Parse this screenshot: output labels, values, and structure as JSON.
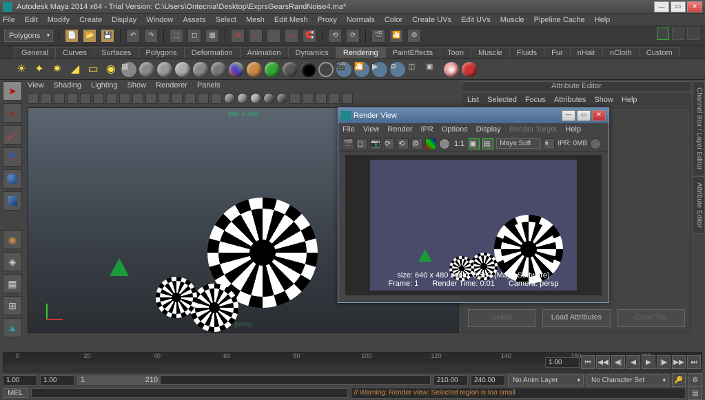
{
  "titlebar": {
    "text": "Autodesk Maya 2014 x64 - Trial Version: C:\\Users\\Ontecnia\\Desktop\\ExprsGearsRandNoise4.ma*"
  },
  "mainmenu": [
    "File",
    "Edit",
    "Modify",
    "Create",
    "Display",
    "Window",
    "Assets",
    "Select",
    "Mesh",
    "Edit Mesh",
    "Proxy",
    "Normals",
    "Color",
    "Create UVs",
    "Edit UVs",
    "Muscle",
    "Pipeline Cache",
    "Help"
  ],
  "mode_dropdown": "Polygons",
  "shelf_tabs": [
    "General",
    "Curves",
    "Surfaces",
    "Polygons",
    "Deformation",
    "Animation",
    "Dynamics",
    "Rendering",
    "PaintEffects",
    "Toon",
    "Muscle",
    "Fluids",
    "Fur",
    "nHair",
    "nCloth",
    "Custom"
  ],
  "shelf_active": "Rendering",
  "panel_menu": [
    "View",
    "Shading",
    "Lighting",
    "Show",
    "Renderer",
    "Panels"
  ],
  "viewport": {
    "dimensions": "640 x 480",
    "camera_label": "persp"
  },
  "attr_editor": {
    "title": "Attribute Editor",
    "menu": [
      "List",
      "Selected",
      "Focus",
      "Attributes",
      "Show",
      "Help"
    ],
    "buttons": {
      "select": "Select",
      "load": "Load Attributes",
      "copy": "Copy Tab"
    }
  },
  "right_tabs": [
    "Channel Box / Layer Editor",
    "Attribute Editor"
  ],
  "render_view": {
    "title": "Render View",
    "menu": [
      "File",
      "View",
      "Render",
      "IPR",
      "Options",
      "Display",
      "Render Target",
      "Help"
    ],
    "renderer_dd": "Maya Soft",
    "ipr_label": "IPR: 0MB",
    "ratio": "1:1",
    "info_line1": "size: 640 x 480    zoom: 0.567    (Maya Software)",
    "info_line2_frame": "Frame: 1",
    "info_line2_time": "Render Time: 0:01",
    "info_line2_cam": "Camera: persp"
  },
  "timeline": {
    "ticks": [
      "0",
      "20",
      "40",
      "60",
      "80",
      "100",
      "120",
      "140",
      "160",
      "180"
    ],
    "time_field": "1.00"
  },
  "range": {
    "start_outer": "1.00",
    "start_inner": "1.00",
    "end_inner": "210.00",
    "end_outer": "240.00",
    "handle_start": "1",
    "handle_end": "210",
    "anim_layer": "No Anim Layer",
    "char_set": "No Character Set"
  },
  "cmdline": {
    "label": "MEL",
    "result": "// Warning: Render view: Selected region is too small"
  }
}
